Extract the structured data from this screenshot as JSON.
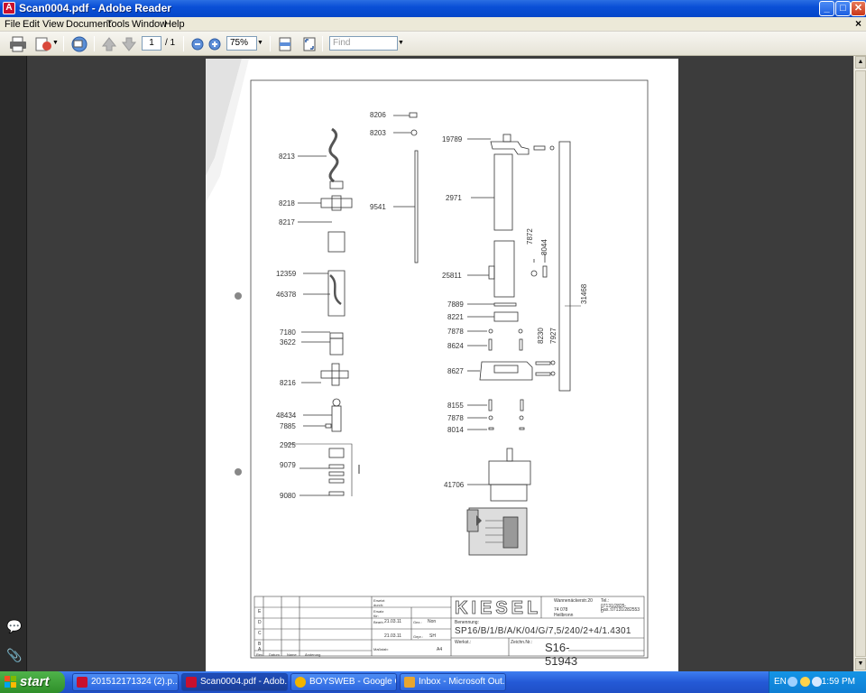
{
  "window": {
    "title": "Scan0004.pdf - Adobe Reader",
    "minimize_glyph": "_",
    "maximize_glyph": "□",
    "close_glyph": "✕",
    "icon_glyph": "A"
  },
  "menubar": {
    "items": [
      "File",
      "Edit",
      "View",
      "Document",
      "Tools",
      "Window",
      "Help"
    ],
    "doc_close_glyph": "×"
  },
  "toolbar": {
    "current_page": "1",
    "total_pages": "/ 1",
    "zoom": "75%",
    "find_placeholder": "Find"
  },
  "drawing": {
    "part_numbers_left": [
      "8206",
      "8203",
      "8213",
      "8218",
      "8217",
      "9541",
      "12359",
      "46378",
      "7180",
      "3622",
      "8216",
      "48434",
      "7885",
      "2925",
      "9079",
      "9080"
    ],
    "part_numbers_right": [
      "19789",
      "2971",
      "25811",
      "7872",
      "8044",
      "31468",
      "7889",
      "8221",
      "7878",
      "8624",
      "8230",
      "7927",
      "8627",
      "8155",
      "7878",
      "8014",
      "41706"
    ],
    "title_block": {
      "company": "KIESEL",
      "address_line1": "Wannenäckerstr.20",
      "address_line2": "74 078 Heilbronn",
      "tel": "Tel.: 07131/2825-0",
      "fax": "Fax.:07131/282553",
      "benennung_label": "Benennung:",
      "designation": "SP16/B/1/B/A/K/04/G/7,5/240/2+4/1.4301",
      "drawing_no_label": "Zeichn.Nr.:",
      "drawing_no": "S16-51943",
      "werkst_label": "Werkst.:",
      "date1": "21.03.11",
      "date2": "21.03.11",
      "gez_label": "Gez.:",
      "gez_value": "Non",
      "gepr_label": "Gepr.:",
      "gepr_value": "SH",
      "bearb_label": "Bearb.",
      "mastab_label": "Maßstab:",
      "ersatz_label": "Ersatz für:",
      "ersetzt_label": "Ersetzt durch:",
      "rev_letters": [
        "E",
        "D",
        "C",
        "B",
        "A"
      ],
      "rev_headers": [
        "Rev.",
        "Datum",
        "Name",
        "Änderung"
      ],
      "a4": "A4"
    }
  },
  "taskbar": {
    "start_label": "start",
    "tasks": [
      {
        "label": "201512171324 (2).p...",
        "color": "#c8102e"
      },
      {
        "label": "Scan0004.pdf - Adob...",
        "color": "#c8102e"
      },
      {
        "label": "BOYSWEB - Google C...",
        "color": "#f2b400"
      },
      {
        "label": "Inbox - Microsoft Out...",
        "color": "#e8a630"
      }
    ],
    "language": "EN",
    "clock": "1:59 PM"
  },
  "colors": {
    "titlebar": "#0a4fd6",
    "taskbar": "#2459d6",
    "viewer_bg": "#3c3c3c"
  }
}
